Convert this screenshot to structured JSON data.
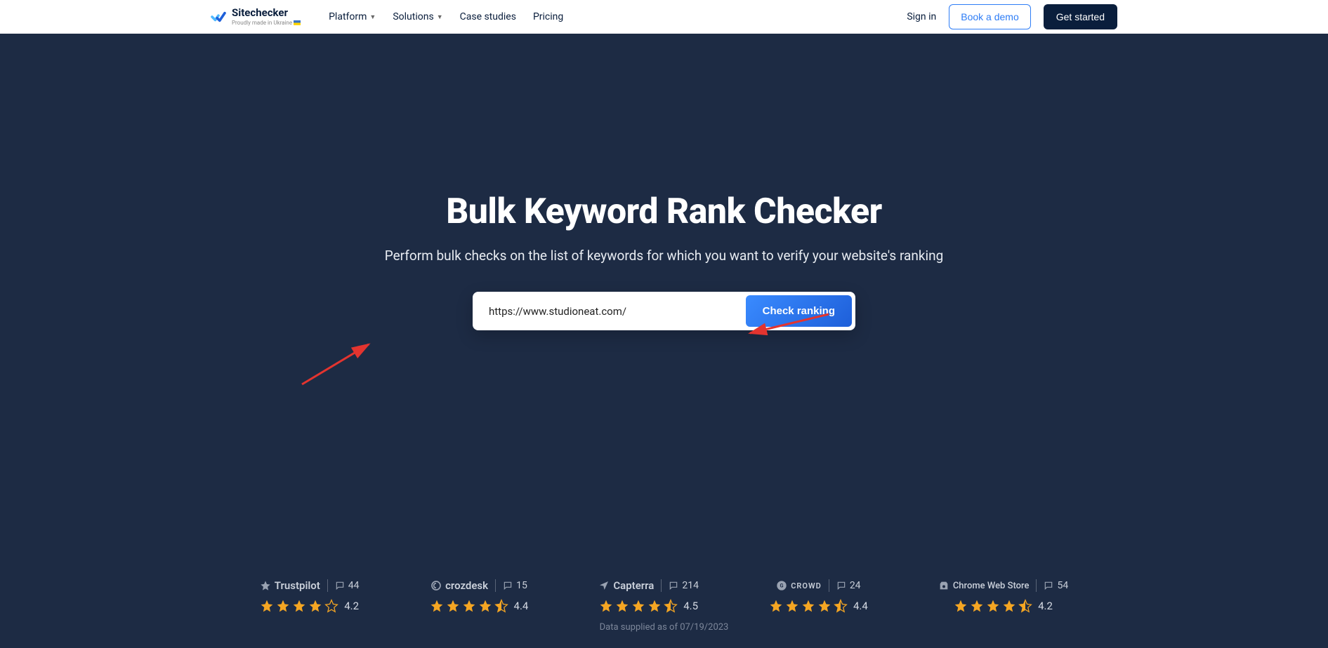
{
  "header": {
    "brand_name": "Sitechecker",
    "brand_tagline": "Proudly made in Ukraine",
    "nav": [
      {
        "label": "Platform",
        "has_dropdown": true
      },
      {
        "label": "Solutions",
        "has_dropdown": true
      },
      {
        "label": "Case studies",
        "has_dropdown": false
      },
      {
        "label": "Pricing",
        "has_dropdown": false
      }
    ],
    "signin_label": "Sign in",
    "demo_label": "Book a demo",
    "start_label": "Get started"
  },
  "hero": {
    "title": "Bulk Keyword Rank Checker",
    "subtitle": "Perform bulk checks on the list of keywords for which you want to verify your website's ranking",
    "input_value": "https://www.studioneat.com/",
    "button_label": "Check ranking"
  },
  "reviews": [
    {
      "name": "Trustpilot",
      "count": "44",
      "rating": "4.2",
      "stars_full": 4,
      "stars_half": 0,
      "stars_empty": 1
    },
    {
      "name": "crozdesk",
      "count": "15",
      "rating": "4.4",
      "stars_full": 4,
      "stars_half": 1,
      "stars_empty": 0
    },
    {
      "name": "Capterra",
      "count": "214",
      "rating": "4.5",
      "stars_full": 4,
      "stars_half": 1,
      "stars_empty": 0
    },
    {
      "name": "CROWD",
      "count": "24",
      "rating": "4.4",
      "stars_full": 4,
      "stars_half": 1,
      "stars_empty": 0
    },
    {
      "name": "Chrome Web Store",
      "count": "54",
      "rating": "4.2",
      "stars_full": 4,
      "stars_half": 1,
      "stars_empty": 0
    }
  ],
  "data_supplied": "Data supplied as of 07/19/2023",
  "colors": {
    "hero_bg": "#1d2b44",
    "accent_blue": "#2e7df6",
    "star_gold": "#f5a623",
    "arrow_red": "#e3342f"
  }
}
